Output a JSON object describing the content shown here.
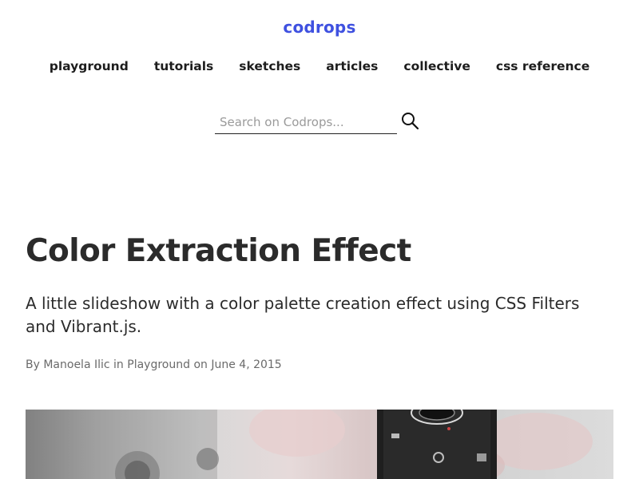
{
  "site": {
    "logo_text": "codrops",
    "brand_color": "#3f51e0"
  },
  "nav": {
    "items": [
      {
        "label": "playground"
      },
      {
        "label": "tutorials"
      },
      {
        "label": "sketches"
      },
      {
        "label": "articles"
      },
      {
        "label": "collective"
      },
      {
        "label": "css reference"
      }
    ]
  },
  "search": {
    "placeholder": "Search on Codrops...",
    "value": "",
    "icon": "search-icon"
  },
  "article": {
    "title": "Color Extraction Effect",
    "subtitle": "A little slideshow with a color palette creation effect using CSS Filters and Vibrant.js.",
    "byline": {
      "prefix": "By",
      "author": "Manoela Ilic",
      "in_text": "in",
      "category": "Playground",
      "on_text": "on",
      "date": "June 4, 2015"
    },
    "hero_image": {
      "alt": "camera-photo"
    }
  }
}
